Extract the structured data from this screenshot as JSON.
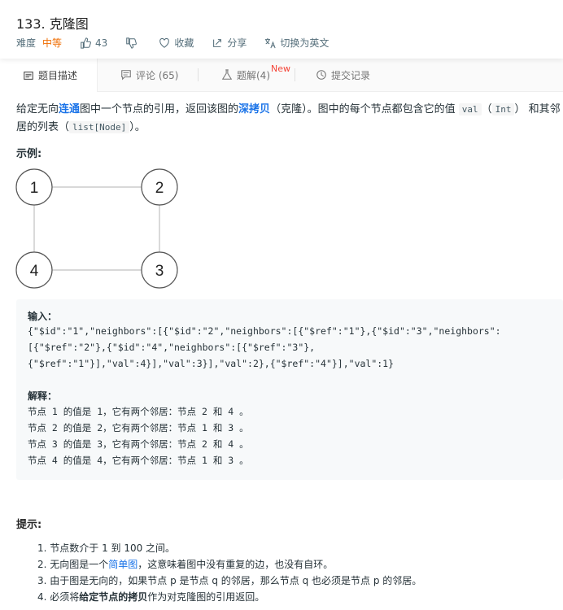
{
  "problem": {
    "title": "133. 克隆图",
    "difficulty_label": "难度",
    "difficulty": "中等",
    "likes": "43",
    "favorite": "收藏",
    "share": "分享",
    "switch_lang": "切换为英文"
  },
  "tabs": [
    {
      "label": "题目描述"
    },
    {
      "label": "评论 (65)"
    },
    {
      "label": "题解(4)",
      "badge": "New"
    },
    {
      "label": "提交记录"
    }
  ],
  "description": {
    "p1": "给定无向",
    "p1_link": "连通",
    "p2": "图中一个节点的引用，返回该图的",
    "p2_bold": "深拷贝",
    "p3": "（克隆）。图中的每个节点都包含它的值 ",
    "code_val": "val",
    "p4": "（",
    "code_int": "Int",
    "p5": "） 和其邻",
    "p6": "居的列表（",
    "code_list": "list[Node]",
    "p7": "）。"
  },
  "example": {
    "heading": "示例:",
    "nodes": [
      "1",
      "2",
      "4",
      "3"
    ],
    "input_label": "输入：",
    "input_lines": [
      "{\"$id\":\"1\",\"neighbors\":[{\"$id\":\"2\",\"neighbors\":[{\"$ref\":\"1\"},{\"$id\":\"3\",\"neighbors\":",
      "[{\"$ref\":\"2\"},{\"$id\":\"4\",\"neighbors\":[{\"$ref\":\"3\"},",
      "{\"$ref\":\"1\"}],\"val\":4}],\"val\":3}],\"val\":2},{\"$ref\":\"4\"}],\"val\":1}"
    ],
    "explain_label": "解释：",
    "explain_lines": [
      "节点 1 的值是 1，它有两个邻居：节点 2 和 4 。",
      "节点 2 的值是 2，它有两个邻居：节点 1 和 3 。",
      "节点 3 的值是 3，它有两个邻居：节点 2 和 4 。",
      "节点 4 的值是 4，它有两个邻居：节点 1 和 3 。"
    ]
  },
  "tips": {
    "heading": "提示:",
    "t1": "1. 节点数介于 1 到 100 之间。",
    "t2a": "2. 无向图是一个",
    "t2link": "简单图",
    "t2b": "，这意味着图中没有重复的边，也没有自环。",
    "t3": "3. 由于图是无向的，如果节点 p 是节点 q 的邻居，那么节点 q 也必须是节点 p 的邻居。",
    "t4a": "4. 必须将",
    "t4bold": "给定节点的拷贝",
    "t4b": "作为对克隆图的引用返回。"
  },
  "colors": {
    "accent": "#1a73e8",
    "difficulty": "#ef6c00",
    "new_badge": "#f44336"
  }
}
